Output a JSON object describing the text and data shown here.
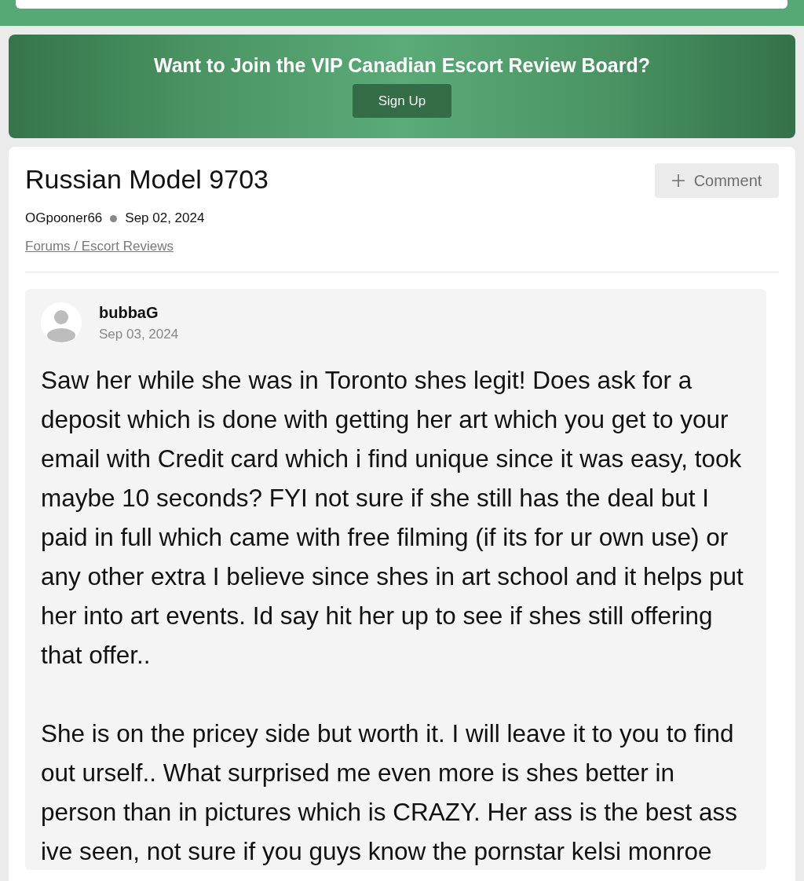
{
  "banner": {
    "title": "Want to Join the VIP Canadian Escort Review Board?",
    "button": "Sign Up"
  },
  "thread": {
    "title": "Russian Model 9703",
    "comment_button": "Comment",
    "author": "OGpooner66",
    "date": "Sep 02, 2024",
    "breadcrumb": "Forums / Escort Reviews"
  },
  "posts": [
    {
      "author": "bubbaG",
      "date": "Sep 03, 2024",
      "paragraphs": [
        "Saw her while she was in Toronto shes legit! Does ask for a deposit which is done with getting her art which you get to your email with Credit card which i find unique since it was easy, took maybe 10 seconds? FYI not sure if she still has the deal but I paid in full which came with free filming (if its for ur own use) or any other extra I believe since shes in art school and it helps put her into art events. Id say hit her up to see if shes still offering that offer..",
        "She is on the pricey side but worth it. I will leave it to you to find out urself.. What surprised me even more is shes better in person than in pictures which is CRAZY. Her ass is the best ass ive seen, not sure if you guys know the pornstar kelsi monroe"
      ]
    }
  ]
}
